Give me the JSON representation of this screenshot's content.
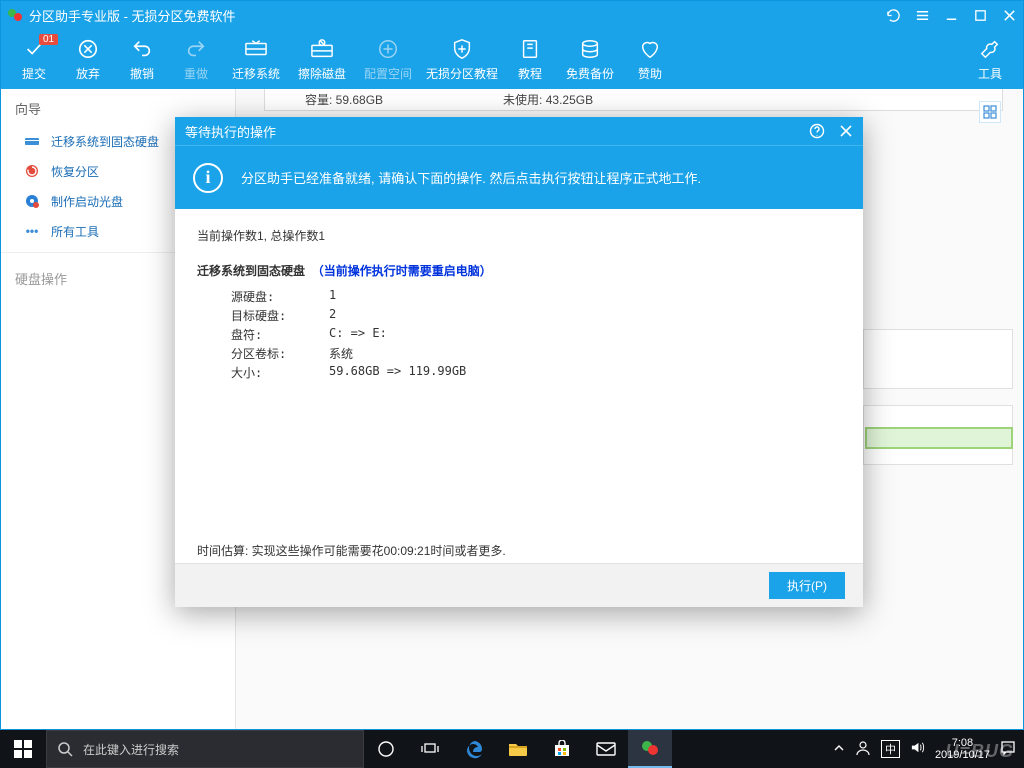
{
  "title": "分区助手专业版 - 无损分区免费软件",
  "toolbar": {
    "submit": "提交",
    "submit_badge": "01",
    "discard": "放弃",
    "undo": "撤销",
    "redo": "重做",
    "migrate": "迁移系统",
    "wipe": "擦除磁盘",
    "allocate": "配置空间",
    "lossless": "无损分区教程",
    "tutorial": "教程",
    "backup": "免费备份",
    "donate": "赞助",
    "tools": "工具"
  },
  "sidebar": {
    "section1": "向导",
    "items": [
      "迁移系统到固态硬盘",
      "恢复分区",
      "制作启动光盘",
      "所有工具"
    ],
    "section2": "硬盘操作"
  },
  "bg": {
    "capacity_lbl": "容量: 59.68GB",
    "free_lbl": "未使用: 43.25GB"
  },
  "modal": {
    "title": "等待执行的操作",
    "banner": "分区助手已经准备就绪, 请确认下面的操作. 然后点击执行按钮让程序正式地工作.",
    "summary": "当前操作数1, 总操作数1",
    "op_title": "迁移系统到固态硬盘",
    "op_warn": "（当前操作执行时需要重启电脑）",
    "rows": [
      {
        "lbl": "源硬盘:",
        "val": "1"
      },
      {
        "lbl": "目标硬盘:",
        "val": "2"
      },
      {
        "lbl": "盘符:",
        "val": "C: => E:"
      },
      {
        "lbl": "分区卷标:",
        "val": "系统"
      },
      {
        "lbl": "大小:",
        "val": "59.68GB => 119.99GB"
      }
    ],
    "time_est": "时间估算: 实现这些操作可能需要花00:09:21时间或者更多.",
    "execute": "执行(P)"
  },
  "taskbar": {
    "search_placeholder": "在此键入进行搜索",
    "ime": "中",
    "time": "7:08",
    "date": "2019/10/17"
  },
  "watermark": "U=BUG"
}
